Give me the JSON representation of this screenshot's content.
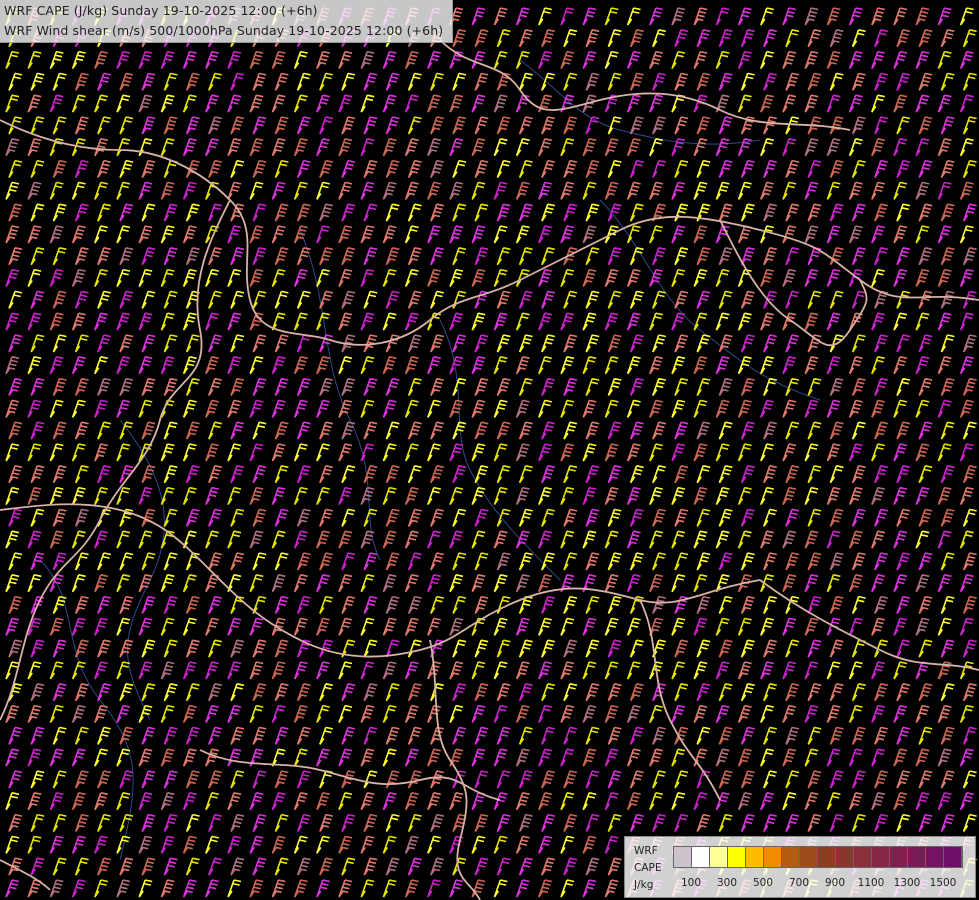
{
  "header": {
    "line1": "WRF CAPE (J/kg) Sunday 19-10-2025 12:00 (+6h)",
    "line2": "WRF Wind shear (m/s) 500/1000hPa Sunday 19-10-2025 12:00 (+6h)"
  },
  "legend": {
    "model": "WRF",
    "variable": "CAPE",
    "unit": "J/kg",
    "swatches": [
      "#ccc3cc",
      "#ffffff",
      "#ffff99",
      "#ffff00",
      "#ffbb00",
      "#f08c00",
      "#b35c0f",
      "#9e4a1a",
      "#8f3d22",
      "#8a3530",
      "#8a2f3c",
      "#852845",
      "#80204f",
      "#7a1a57",
      "#741460",
      "#6e0e69"
    ],
    "ticks": [
      "100",
      "300",
      "500",
      "700",
      "900",
      "1100",
      "1300",
      "1500"
    ]
  },
  "map": {
    "background": "#000000",
    "barb_colors": [
      "#e6e600",
      "#ffff33",
      "#cc22cc",
      "#dd33dd",
      "#e07a6e",
      "#cc6655",
      "#b07080"
    ],
    "border_color": "#d9b3a6",
    "river_color": "#2c4a8a",
    "icon": "wind-barb-icon"
  }
}
